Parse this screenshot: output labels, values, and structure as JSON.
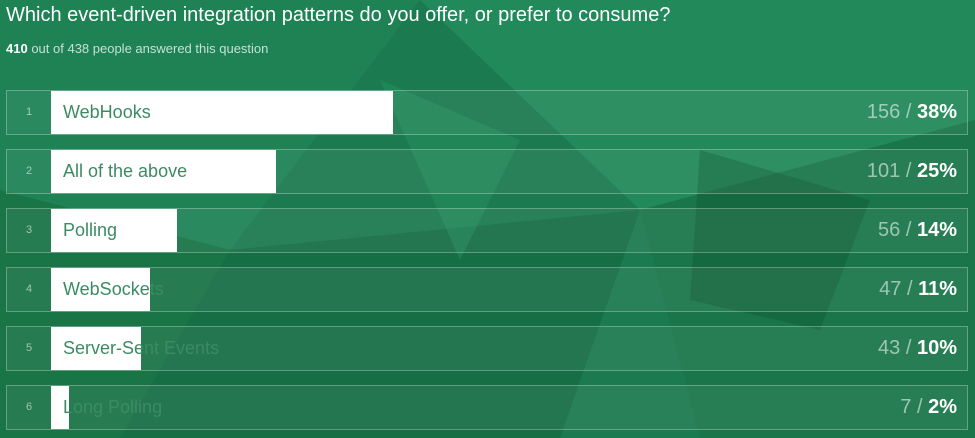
{
  "question": "Which event-driven integration patterns do you offer, or prefer to consume?",
  "responses": {
    "answered": "410",
    "rest": "out of 438 people answered this question"
  },
  "colors": {
    "background": "#1b7a4f",
    "bar": "#ffffff",
    "label": "#3c8a64"
  },
  "chart_data": {
    "type": "bar",
    "orientation": "horizontal",
    "title": "Which event-driven integration patterns do you offer, or prefer to consume?",
    "categories": [
      "WebHooks",
      "All of the above",
      "Polling",
      "WebSockets",
      "Server-Sent Events",
      "Long Polling"
    ],
    "counts": [
      156,
      101,
      56,
      47,
      43,
      7
    ],
    "percent": [
      38,
      25,
      14,
      11,
      10,
      2
    ],
    "rows": [
      {
        "rank": "1",
        "label": "WebHooks",
        "count": "156",
        "pct": "38%"
      },
      {
        "rank": "2",
        "label": "All of the above",
        "count": "101",
        "pct": "25%"
      },
      {
        "rank": "3",
        "label": "Polling",
        "count": "56",
        "pct": "14%"
      },
      {
        "rank": "4",
        "label": "WebSockets",
        "count": "47",
        "pct": "11%"
      },
      {
        "rank": "5",
        "label": "Server-Sent Events",
        "count": "43",
        "pct": "10%"
      },
      {
        "rank": "6",
        "label": "Long Polling",
        "count": "7",
        "pct": "2%"
      }
    ]
  }
}
